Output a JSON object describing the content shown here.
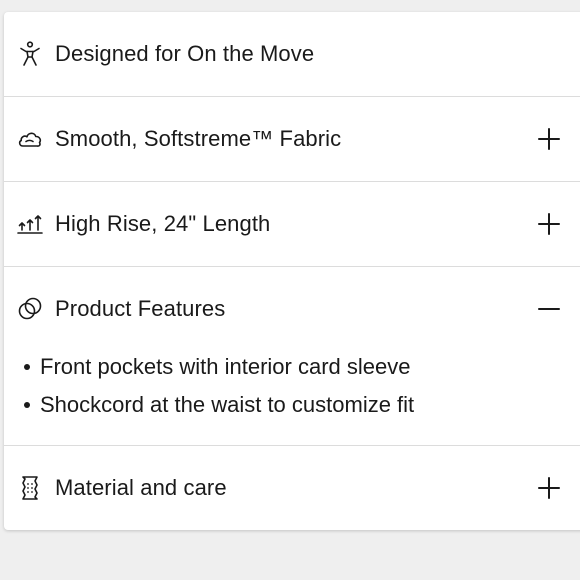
{
  "accordion": {
    "items": [
      {
        "icon": "person-moving-icon",
        "label": "Designed for On the Move",
        "toggle": ""
      },
      {
        "icon": "cloud-icon",
        "label": "Smooth, Softstreme™ Fabric",
        "toggle": "plus"
      },
      {
        "icon": "rise-arrows-icon",
        "label": "High Rise, 24\" Length",
        "toggle": "plus"
      },
      {
        "icon": "overlapping-circles-icon",
        "label": "Product Features",
        "toggle": "minus"
      },
      {
        "icon": "care-label-icon",
        "label": "Material and care",
        "toggle": "plus"
      }
    ],
    "expanded_features": [
      "Front pockets with interior card sleeve",
      "Shockcord at the waist to customize fit"
    ]
  }
}
